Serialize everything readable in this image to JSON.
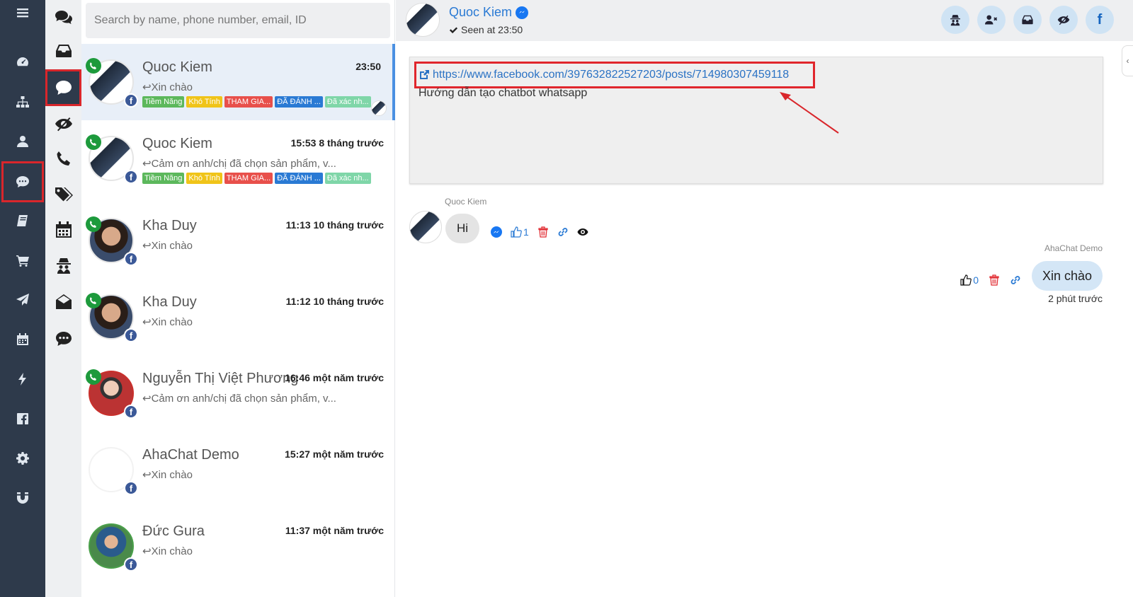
{
  "search": {
    "placeholder": "Search by name, phone number, email, ID"
  },
  "conversations": [
    {
      "name": "Quoc Kiem",
      "time": "23:50",
      "preview": "Xin chào",
      "tags": [
        "Tiềm Năng",
        "Khó Tính",
        "THAM GIA...",
        "ĐÃ ĐÁNH ...",
        "Đã xác nh..."
      ]
    },
    {
      "name": "Quoc Kiem",
      "time": "15:53 8 tháng trước",
      "preview": "Cảm ơn anh/chị đã chọn sản phẩm, v...",
      "tags": [
        "Tiềm Năng",
        "Khó Tính",
        "THAM GIA...",
        "ĐÃ ĐÁNH ...",
        "Đã xác nh..."
      ]
    },
    {
      "name": "Kha Duy",
      "time": "11:13 10 tháng trước",
      "preview": "Xin chào"
    },
    {
      "name": "Kha Duy",
      "time": "11:12 10 tháng trước",
      "preview": "Xin chào"
    },
    {
      "name": "Nguyễn Thị Việt Phương",
      "time": "16:46 một năm trước",
      "preview": "Cảm ơn anh/chị đã chọn sản phẩm, v..."
    },
    {
      "name": "AhaChat Demo",
      "time": "15:27 một năm trước",
      "preview": "Xin chào"
    },
    {
      "name": "Đức Gura",
      "time": "11:37 một năm trước",
      "preview": "Xin chào"
    }
  ],
  "tag_colors": [
    "#5cb85c",
    "#f0c419",
    "#e8504b",
    "#2a7ad4",
    "#7fd6a8"
  ],
  "chat": {
    "contact_name": "Quoc Kiem",
    "seen": "Seen at 23:50",
    "post_link": "https://www.facebook.com/397632822527203/posts/714980307459118",
    "post_text": "Hướng dẫn tạo chatbot whatsapp",
    "incoming": {
      "sender": "Quoc Kiem",
      "text": "Hi",
      "like_count": "1"
    },
    "outgoing": {
      "sender": "AhaChat Demo",
      "text": "Xin chào",
      "like_count": "0",
      "time": "2 phút trước"
    }
  },
  "icons": {
    "rail": [
      "menu-icon",
      "dashboard-icon",
      "sitemap-icon",
      "user-icon",
      "chat-icon",
      "book-icon",
      "cart-icon",
      "send-icon",
      "calendar-icon",
      "bolt-icon",
      "facebook-square-icon",
      "gear-icon",
      "magnet-icon"
    ],
    "col2": [
      "comments-icon",
      "inbox-icon",
      "comment-icon",
      "eye-slash-icon",
      "phone-icon",
      "tags-icon",
      "calendar-icon",
      "spy-icon",
      "envelope-open-icon",
      "commenting-icon"
    ]
  }
}
